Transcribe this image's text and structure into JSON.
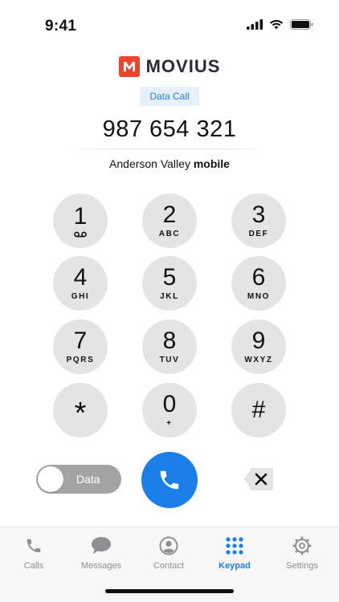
{
  "status": {
    "time": "9:41"
  },
  "brand": {
    "name": "MOVIUS"
  },
  "dialer": {
    "mode_badge": "Data Call",
    "number": "987 654 321",
    "contact_name": "Anderson Valley",
    "contact_type": "mobile"
  },
  "keys": [
    {
      "digit": "1",
      "letters": ""
    },
    {
      "digit": "2",
      "letters": "ABC"
    },
    {
      "digit": "3",
      "letters": "DEF"
    },
    {
      "digit": "4",
      "letters": "GHI"
    },
    {
      "digit": "5",
      "letters": "JKL"
    },
    {
      "digit": "6",
      "letters": "MNO"
    },
    {
      "digit": "7",
      "letters": "PQRS"
    },
    {
      "digit": "8",
      "letters": "TUV"
    },
    {
      "digit": "9",
      "letters": "WXYZ"
    },
    {
      "digit": "*",
      "letters": ""
    },
    {
      "digit": "0",
      "letters": "+"
    },
    {
      "digit": "#",
      "letters": ""
    }
  ],
  "controls": {
    "toggle_label": "Data",
    "toggle_on": false
  },
  "tabs": [
    {
      "label": "Calls",
      "icon": "phone-icon",
      "active": false
    },
    {
      "label": "Messages",
      "icon": "chat-bubble-icon",
      "active": false
    },
    {
      "label": "Contact",
      "icon": "person-icon",
      "active": false
    },
    {
      "label": "Keypad",
      "icon": "keypad-grid-icon",
      "active": true
    },
    {
      "label": "Settings",
      "icon": "gear-icon",
      "active": false
    }
  ],
  "colors": {
    "accent": "#1a7fe8",
    "brand": "#e8452c",
    "key_bg": "#e4e4e6",
    "toggle_bg": "#a4a4a6",
    "tab_inactive": "#8e8e93"
  }
}
